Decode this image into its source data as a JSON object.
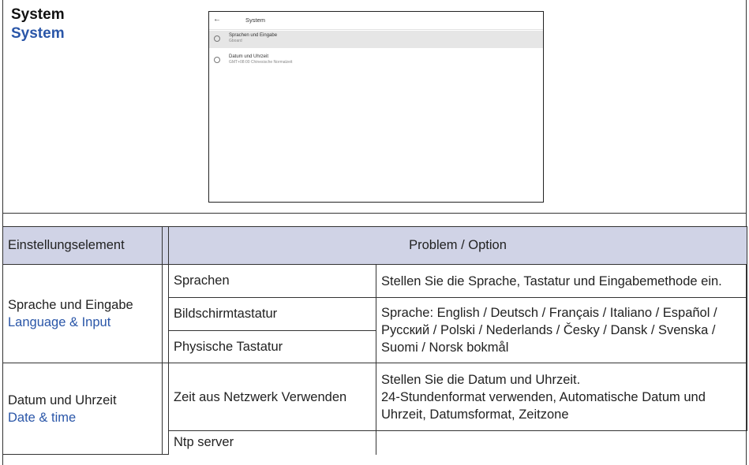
{
  "header": {
    "title": "System",
    "subtitle": "System"
  },
  "screen": {
    "back_icon": "arrow-left-icon",
    "title": "System",
    "items": [
      {
        "icon": "globe-icon",
        "title": "Sprachen und Eingabe",
        "subtitle": "Gboard"
      },
      {
        "icon": "clock-icon",
        "title": "Datum und Uhrzeit",
        "subtitle": "GMT+08:00 Chinesische Normalzeit"
      }
    ]
  },
  "table": {
    "headers": [
      "Einstellungselement",
      "Problem / Option"
    ],
    "group1": {
      "name": "Sprache und Eingabe",
      "name_en": "Language & Input",
      "items": [
        "Sprachen",
        "Bildschirmtastatur",
        "Physische Tastatur"
      ],
      "desc1": "Stellen Sie die Sprache, Tastatur und Eingabemethode ein.",
      "desc2": "Sprache: English / Deutsch / Français / Italiano / Español / Русский / Polski / Nederlands / Česky / Dansk / Svenska / Suomi / Norsk bokmål"
    },
    "group2": {
      "name": "Datum und Uhrzeit",
      "name_en": "Date & time",
      "items": [
        "Zeit aus Netzwerk Verwenden",
        "Ntp server"
      ],
      "desc1": "Stellen Sie die Datum und Uhrzeit.",
      "desc2": "24-Stundenformat verwenden, Automatische Datum und Uhrzeit, Datumsformat, Zeitzone"
    }
  }
}
